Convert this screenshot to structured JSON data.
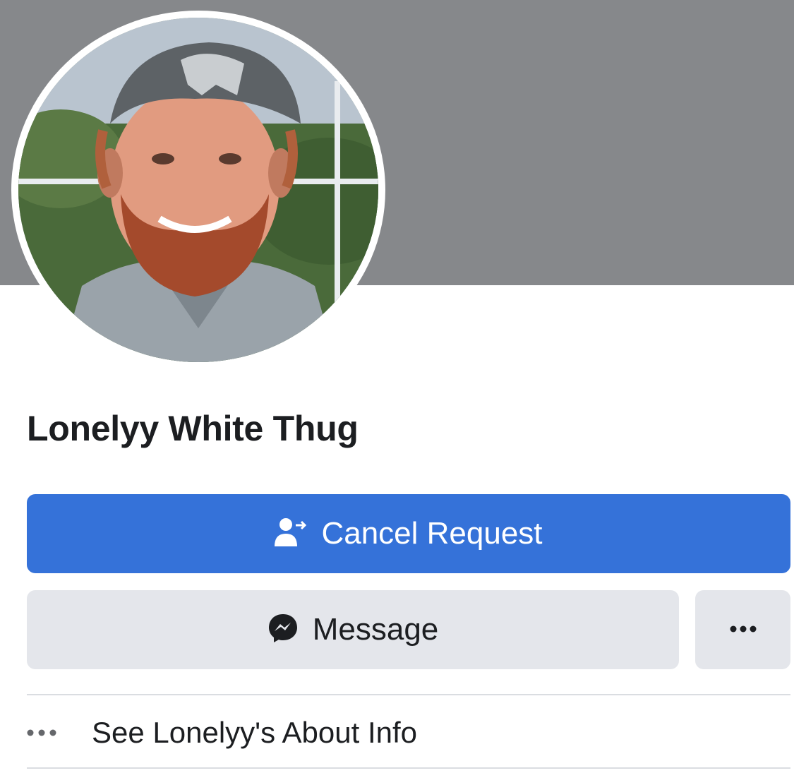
{
  "profile": {
    "name": "Lonelyy White Thug",
    "avatar_icon": "profile-photo",
    "cover_color": "#86888b"
  },
  "actions": {
    "primary": {
      "label": "Cancel Request",
      "icon": "person-arrow-icon",
      "color": "#3572d9"
    },
    "secondary": {
      "label": "Message",
      "icon": "messenger-icon",
      "color": "#e4e6eb"
    },
    "more": {
      "icon": "more-dots-icon"
    }
  },
  "about": {
    "label": "See Lonelyy's About Info",
    "icon": "more-dots-icon"
  }
}
